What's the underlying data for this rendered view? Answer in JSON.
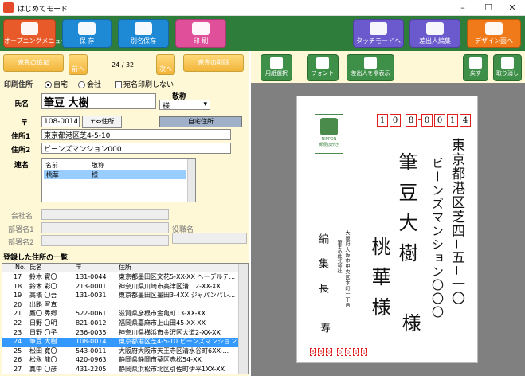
{
  "window": {
    "title": "はじめてモード",
    "minimize": "–",
    "maximize": "☐",
    "close": "✕"
  },
  "toolbar": {
    "opening": "オープニングメニュー",
    "save": "保 存",
    "save_as": "別名保存",
    "print": "印 刷",
    "touch_mode": "タッチモードへ",
    "sender_edit": "差出人編集",
    "to_design": "デザイン面へ"
  },
  "nav": {
    "add": "宛先の追加",
    "prev": "前へ",
    "counter": "24 / 32",
    "next": "次へ",
    "delete": "宛先の削除"
  },
  "form": {
    "print_address_label": "印刷住所",
    "opt_home": "自宅",
    "opt_company": "会社",
    "opt_no_print": "宛名印刷しない",
    "name_label": "氏名",
    "name_value": "筆豆 大樹",
    "honorific_label": "敬称",
    "honorific_value": "様",
    "zip_label": "〒",
    "zip_value": "108-0014",
    "zip_convert": "〒⇔住所",
    "home_address_btn": "自宅住所",
    "address1_label": "住所1",
    "address1_value": "東京都港区芝4-5-10",
    "address2_label": "住所2",
    "address2_value": "ビーンズマンション000",
    "joint_label": "連名",
    "joint_col_name": "名前",
    "joint_col_honor": "敬称",
    "joint_rows": [
      {
        "name": "桃華",
        "honor": "様"
      }
    ],
    "company_label": "会社名",
    "dept1_label": "部署名1",
    "title_label": "役職名",
    "dept2_label": "部署名2"
  },
  "list": {
    "heading": "登録した住所の一覧",
    "cols": {
      "no": "No.",
      "name": "氏名",
      "zip": "〒",
      "address": "住所"
    },
    "rows": [
      {
        "no": "17",
        "name": "鈴木 實〇",
        "zip": "131-0044",
        "address": "東京都墨田区文花5-XX-XX ヘーデルテ..."
      },
      {
        "no": "18",
        "name": "鈴木 彩〇",
        "zip": "213-0001",
        "address": "神奈川県川崎市高津区溝口2-XX-XX"
      },
      {
        "no": "19",
        "name": "高橋 〇吾",
        "zip": "131-0031",
        "address": "東京都墨田区墨田3-4XX ジャパンパレ..."
      },
      {
        "no": "20",
        "name": "出路 写真",
        "zip": "",
        "address": ""
      },
      {
        "no": "21",
        "name": "鷹〇 秀郷",
        "zip": "522-0061",
        "address": "滋賀県彦根市金亀町13-XX-XX"
      },
      {
        "no": "22",
        "name": "日野 〇明",
        "zip": "821-0012",
        "address": "福岡県嘉麻市上山田45-XX-XX"
      },
      {
        "no": "23",
        "name": "日野 〇子",
        "zip": "236-0035",
        "address": "神奈川県横浜市金沢区大道2-XX-XX"
      },
      {
        "no": "24",
        "name": "筆豆 大樹",
        "zip": "108-0014",
        "address": "東京都港区芝4-5-10 ビーンズマンション..."
      },
      {
        "no": "25",
        "name": "松田 寛〇",
        "zip": "543-0011",
        "address": "大阪府大阪市天王寺区清水谷町6XX-..."
      },
      {
        "no": "26",
        "name": "松永 龍〇",
        "zip": "420-0963",
        "address": "静岡県静岡市葵区赤松54-XX"
      },
      {
        "no": "27",
        "name": "真中 〇彦",
        "zip": "431-2205",
        "address": "静岡県浜松市北区引佐町伊平1XX-XX"
      }
    ]
  },
  "preview_toolbar": {
    "paper_select": "用紙選択",
    "font": "フォント",
    "hide_sender": "差出人を非表示",
    "undo": "戻す",
    "redo": "取り消し"
  },
  "postcard": {
    "zip_digits": [
      "1",
      "0",
      "8",
      "0",
      "0",
      "1",
      "4"
    ],
    "stamp_text": "NIPPON",
    "stamp_sub": "郵便はがき",
    "address_line1": "東京都港区芝四−五−一〇",
    "address_line2": "ビーンズマンション〇〇〇",
    "name_line1": "筆豆大樹",
    "name_line2": "桃華様",
    "sama1": "様",
    "sender_address": "大阪府大阪市中央区本町一丁目",
    "sender_name": "筆まめ株式会社",
    "sender_title": "編集長",
    "sender_name2": "寿",
    "sender_zip": [
      "5",
      "5",
      "0",
      "0",
      "0",
      "1",
      "1"
    ]
  },
  "colors": {
    "toolbar_green": "#2f7d3a",
    "pane_cream": "#fff8d6",
    "select_blue": "#3399ff",
    "zip_red": "#e02020"
  }
}
